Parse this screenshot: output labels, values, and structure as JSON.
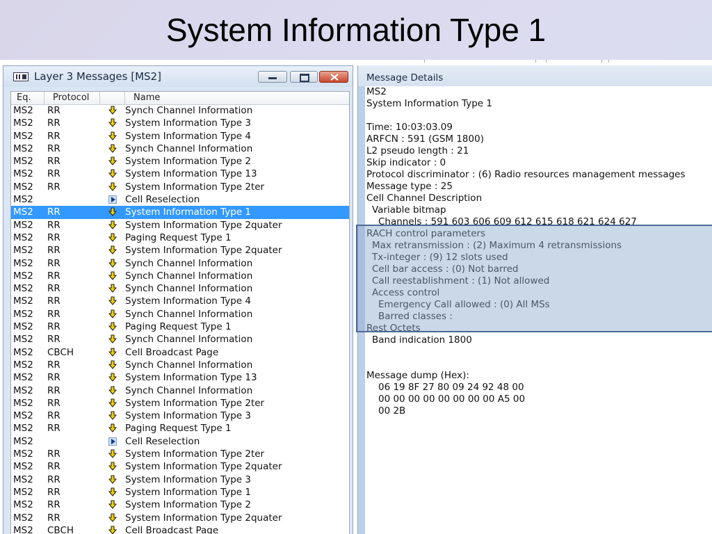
{
  "slide": {
    "title": "System Information Type 1"
  },
  "layer3_window": {
    "title": "Layer 3 Messages  [MS2]",
    "columns": {
      "eq": "Eq.",
      "protocol": "Protocol",
      "name": "Name"
    },
    "rows": [
      {
        "eq": "MS2",
        "protocol": "RR",
        "icon": "down-arrow-icon",
        "name": "Synch Channel Information"
      },
      {
        "eq": "MS2",
        "protocol": "RR",
        "icon": "down-arrow-icon",
        "name": "System Information Type 3"
      },
      {
        "eq": "MS2",
        "protocol": "RR",
        "icon": "down-arrow-icon",
        "name": "System Information Type 4"
      },
      {
        "eq": "MS2",
        "protocol": "RR",
        "icon": "down-arrow-icon",
        "name": "Synch Channel Information"
      },
      {
        "eq": "MS2",
        "protocol": "RR",
        "icon": "down-arrow-icon",
        "name": "System Information Type 2"
      },
      {
        "eq": "MS2",
        "protocol": "RR",
        "icon": "down-arrow-icon",
        "name": "System Information Type 13"
      },
      {
        "eq": "MS2",
        "protocol": "RR",
        "icon": "down-arrow-icon",
        "name": "System Information Type 2ter"
      },
      {
        "eq": "MS2",
        "protocol": "",
        "icon": "play-icon",
        "name": "Cell Reselection"
      },
      {
        "eq": "MS2",
        "protocol": "RR",
        "icon": "down-arrow-icon",
        "name": "System Information Type 1",
        "selected": true
      },
      {
        "eq": "MS2",
        "protocol": "RR",
        "icon": "down-arrow-icon",
        "name": "System Information Type 2quater"
      },
      {
        "eq": "MS2",
        "protocol": "RR",
        "icon": "down-arrow-icon",
        "name": "Paging Request Type 1"
      },
      {
        "eq": "MS2",
        "protocol": "RR",
        "icon": "down-arrow-icon",
        "name": "System Information Type 2quater"
      },
      {
        "eq": "MS2",
        "protocol": "RR",
        "icon": "down-arrow-icon",
        "name": "Synch Channel Information"
      },
      {
        "eq": "MS2",
        "protocol": "RR",
        "icon": "down-arrow-icon",
        "name": "Synch Channel Information"
      },
      {
        "eq": "MS2",
        "protocol": "RR",
        "icon": "down-arrow-icon",
        "name": "Synch Channel Information"
      },
      {
        "eq": "MS2",
        "protocol": "RR",
        "icon": "down-arrow-icon",
        "name": "System Information Type 4"
      },
      {
        "eq": "MS2",
        "protocol": "RR",
        "icon": "down-arrow-icon",
        "name": "Synch Channel Information"
      },
      {
        "eq": "MS2",
        "protocol": "RR",
        "icon": "down-arrow-icon",
        "name": "Paging Request Type 1"
      },
      {
        "eq": "MS2",
        "protocol": "RR",
        "icon": "down-arrow-icon",
        "name": "Synch Channel Information"
      },
      {
        "eq": "MS2",
        "protocol": "CBCH",
        "icon": "down-arrow-icon",
        "name": "Cell Broadcast Page"
      },
      {
        "eq": "MS2",
        "protocol": "RR",
        "icon": "down-arrow-icon",
        "name": "Synch Channel Information"
      },
      {
        "eq": "MS2",
        "protocol": "RR",
        "icon": "down-arrow-icon",
        "name": "System Information Type 13"
      },
      {
        "eq": "MS2",
        "protocol": "RR",
        "icon": "down-arrow-icon",
        "name": "Synch Channel Information"
      },
      {
        "eq": "MS2",
        "protocol": "RR",
        "icon": "down-arrow-icon",
        "name": "System Information Type 2ter"
      },
      {
        "eq": "MS2",
        "protocol": "RR",
        "icon": "down-arrow-icon",
        "name": "System Information Type 3"
      },
      {
        "eq": "MS2",
        "protocol": "RR",
        "icon": "down-arrow-icon",
        "name": "Paging Request Type 1"
      },
      {
        "eq": "MS2",
        "protocol": "",
        "icon": "play-icon",
        "name": "Cell Reselection"
      },
      {
        "eq": "MS2",
        "protocol": "RR",
        "icon": "down-arrow-icon",
        "name": "System Information Type 2ter"
      },
      {
        "eq": "MS2",
        "protocol": "RR",
        "icon": "down-arrow-icon",
        "name": "System Information Type 2quater"
      },
      {
        "eq": "MS2",
        "protocol": "RR",
        "icon": "down-arrow-icon",
        "name": "System Information Type 3"
      },
      {
        "eq": "MS2",
        "protocol": "RR",
        "icon": "down-arrow-icon",
        "name": "System Information Type 1"
      },
      {
        "eq": "MS2",
        "protocol": "RR",
        "icon": "down-arrow-icon",
        "name": "System Information Type 2"
      },
      {
        "eq": "MS2",
        "protocol": "RR",
        "icon": "down-arrow-icon",
        "name": "System Information Type 2quater"
      },
      {
        "eq": "MS2",
        "protocol": "CBCH",
        "icon": "down-arrow-icon",
        "name": "Cell Broadcast Page"
      }
    ],
    "selected_color": "#3399ff"
  },
  "details": {
    "title": "Message Details",
    "lines": [
      {
        "text": "MS2",
        "indent": 0
      },
      {
        "text": "System Information Type 1",
        "indent": 0
      },
      {
        "text": "",
        "indent": 0
      },
      {
        "text": "Time: 10:03:03.09",
        "indent": 0
      },
      {
        "text": "ARFCN : 591 (GSM 1800)",
        "indent": 0
      },
      {
        "text": "L2 pseudo length : 21",
        "indent": 0
      },
      {
        "text": "Skip indicator : 0",
        "indent": 0
      },
      {
        "text": "Protocol discriminator : (6) Radio resources management messages",
        "indent": 0
      },
      {
        "text": "Message type : 25",
        "indent": 0
      },
      {
        "text": "Cell Channel Description",
        "indent": 0
      },
      {
        "text": "Variable bitmap",
        "indent": 1
      },
      {
        "text": "Channels : 591 603 606 609 612 615 618 621 624 627",
        "indent": 2
      },
      {
        "text": "RACH control parameters",
        "indent": 0
      },
      {
        "text": "Max retransmission : (2) Maximum 4 retransmissions",
        "indent": 1
      },
      {
        "text": "Tx-integer : (9) 12 slots used",
        "indent": 1
      },
      {
        "text": "Cell bar access : (0) Not barred",
        "indent": 1
      },
      {
        "text": "Call reestablishment : (1) Not allowed",
        "indent": 1
      },
      {
        "text": "Access control",
        "indent": 1
      },
      {
        "text": "Emergency Call allowed : (0) All MSs",
        "indent": 2
      },
      {
        "text": "Barred classes :",
        "indent": 2
      },
      {
        "text": "Rest Octets",
        "indent": 0
      },
      {
        "text": "Band indication 1800",
        "indent": 1
      },
      {
        "text": "",
        "indent": 0
      },
      {
        "text": "",
        "indent": 0
      },
      {
        "text": "Message dump (Hex):",
        "indent": 0
      },
      {
        "text": "06 19 8F 27 80 09 24 92 48 00",
        "indent": 2
      },
      {
        "text": "00 00 00 00 00 00 00 00 A5 00",
        "indent": 2
      },
      {
        "text": "00 2B",
        "indent": 2
      }
    ],
    "highlight_color": "#4a6a96"
  }
}
